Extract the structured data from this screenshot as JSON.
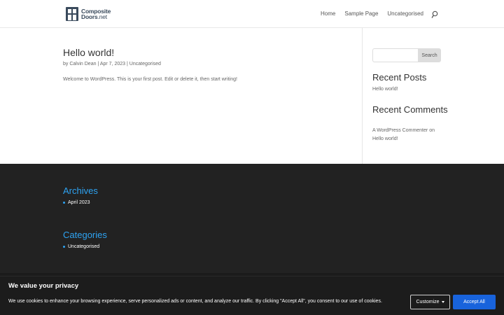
{
  "header": {
    "logo": {
      "line1": "Composite",
      "line2": "Doors",
      "tld": ".net"
    },
    "nav": [
      "Home",
      "Sample Page",
      "Uncategorised"
    ]
  },
  "post": {
    "title": "Hello world!",
    "meta": {
      "by": "by",
      "author": "Calvin Dean",
      "sep": "|",
      "date": "Apr 7, 2023",
      "category": "Uncategorised"
    },
    "excerpt": "Welcome to WordPress. This is your first post. Edit or delete it, then start writing!"
  },
  "sidebar": {
    "search": {
      "placeholder": "",
      "button": "Search"
    },
    "recent_posts": {
      "title": "Recent Posts",
      "items": [
        "Hello world!"
      ]
    },
    "recent_comments": {
      "title": "Recent Comments",
      "author": "A WordPress Commenter",
      "on": "on",
      "post": "Hello world!"
    }
  },
  "footer": {
    "archives": {
      "title": "Archives",
      "items": [
        "April 2023"
      ]
    },
    "categories": {
      "title": "Categories",
      "items": [
        "Uncategorised"
      ]
    }
  },
  "cookie_banner": {
    "title": "We value your privacy",
    "text": "We use cookies to enhance your browsing experience, serve personalized ads or content, and analyze our traffic. By clicking \"Accept All\", you consent to our use of cookies.",
    "customize": "Customize",
    "accept": "Accept All"
  },
  "colors": {
    "accent": "#2ea3f2",
    "footer_bg": "#222222",
    "accept_button": "#1863dc"
  }
}
